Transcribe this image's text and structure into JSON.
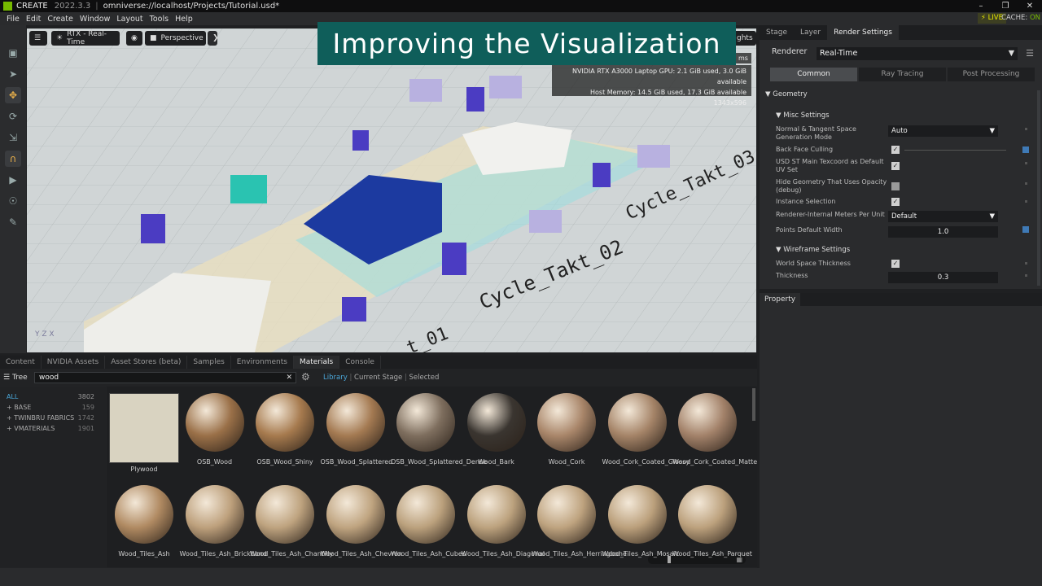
{
  "titlebar": {
    "app": "CREATE",
    "version": "2022.3.3",
    "path": "omniverse://localhost/Projects/Tutorial.usd*"
  },
  "menu": [
    "File",
    "Edit",
    "Create",
    "Window",
    "Layout",
    "Tools",
    "Help"
  ],
  "status": {
    "live": "LIVE",
    "cache_label": "CACHE:",
    "cache_value": "ON"
  },
  "viewport": {
    "render_mode": "RTX - Real-Time",
    "camera": "Perspective",
    "lights_label": "ghts",
    "banner": "Improving the Visualization",
    "hud_ms": "ms",
    "hud": [
      "NVIDIA RTX A3000 Laptop GPU: 2.1 GiB used, 3.0 GiB available",
      "Host Memory: 14.5 GiB used, 17.3 GiB available",
      "1343x596"
    ],
    "scene_labels": [
      "Cycle_Takt_03",
      "Cycle_Takt_02",
      "t_01"
    ]
  },
  "right_panel": {
    "tabs": [
      "Stage",
      "Layer",
      "Render Settings"
    ],
    "renderer_label": "Renderer",
    "renderer_value": "Real-Time",
    "subtabs": [
      "Common",
      "Ray Tracing",
      "Post Processing"
    ],
    "section": "Geometry",
    "misc": "Misc Settings",
    "rows": [
      {
        "label": "Normal & Tangent Space Generation Mode",
        "value": "Auto"
      },
      {
        "label": "Back Face Culling",
        "checked": true
      },
      {
        "label": "USD ST Main Texcoord as Default UV Set",
        "checked": true
      },
      {
        "label": "Hide Geometry That Uses Opacity (debug)",
        "checked": false
      },
      {
        "label": "Instance Selection",
        "checked": true
      },
      {
        "label": "Renderer-Internal Meters Per Unit",
        "value": "Default"
      },
      {
        "label": "Points Default Width",
        "value": "1.0"
      }
    ],
    "wireframe": "Wireframe Settings",
    "wire_rows": [
      {
        "label": "World Space Thickness",
        "checked": true
      },
      {
        "label": "Thickness",
        "value": "0.3"
      }
    ]
  },
  "property": {
    "tab": "Property"
  },
  "bottom_tabs": [
    "Content",
    "NVIDIA Assets",
    "Asset Stores (beta)",
    "Samples",
    "Environments",
    "Materials",
    "Console"
  ],
  "browser": {
    "tree_label": "Tree",
    "search_value": "wood",
    "filters": {
      "library": "Library",
      "current_stage": "Current Stage",
      "selected": "Selected"
    },
    "tree": [
      {
        "label": "ALL",
        "count": "3802"
      },
      {
        "label": "+ BASE",
        "count": "159"
      },
      {
        "label": "+ TWINBRU FABRICS",
        "count": "1742"
      },
      {
        "label": "+ VMATERIALS",
        "count": "1901"
      }
    ],
    "materials": [
      {
        "name": "Plywood",
        "color": "#d9d3c1"
      },
      {
        "name": "OSB_Wood",
        "color": "#9a7048"
      },
      {
        "name": "OSB_Wood_Shiny",
        "color": "#a67a4e"
      },
      {
        "name": "OSB_Wood_Splattered",
        "color": "#a47a52"
      },
      {
        "name": "OSB_Wood_Splattered_Dense",
        "color": "#7e6e5e"
      },
      {
        "name": "Wood_Bark",
        "color": "#3a3530"
      },
      {
        "name": "Wood_Cork",
        "color": "#a9866a"
      },
      {
        "name": "Wood_Cork_Coated_Glossy",
        "color": "#a58468"
      },
      {
        "name": "Wood_Cork_Coated_Matte",
        "color": "#a3826a"
      },
      {
        "name": "Wood_Tiles_Ash",
        "color": "#b08a62"
      },
      {
        "name": "Wood_Tiles_Ash_Brickbond",
        "color": "#bda07c"
      },
      {
        "name": "Wood_Tiles_Ash_Chantilly",
        "color": "#bea37f"
      },
      {
        "name": "Wood_Tiles_Ash_Chevron",
        "color": "#bfa480"
      },
      {
        "name": "Wood_Tiles_Ash_Cubes",
        "color": "#bba17d"
      },
      {
        "name": "Wood_Tiles_Ash_Diagonal",
        "color": "#bca27e"
      },
      {
        "name": "Wood_Tiles_Ash_Herringbone",
        "color": "#bea37f"
      },
      {
        "name": "Wood_Tiles_Ash_Mosaic",
        "color": "#bba07c"
      },
      {
        "name": "Wood_Tiles_Ash_Parquet",
        "color": "#bca17d"
      }
    ]
  }
}
